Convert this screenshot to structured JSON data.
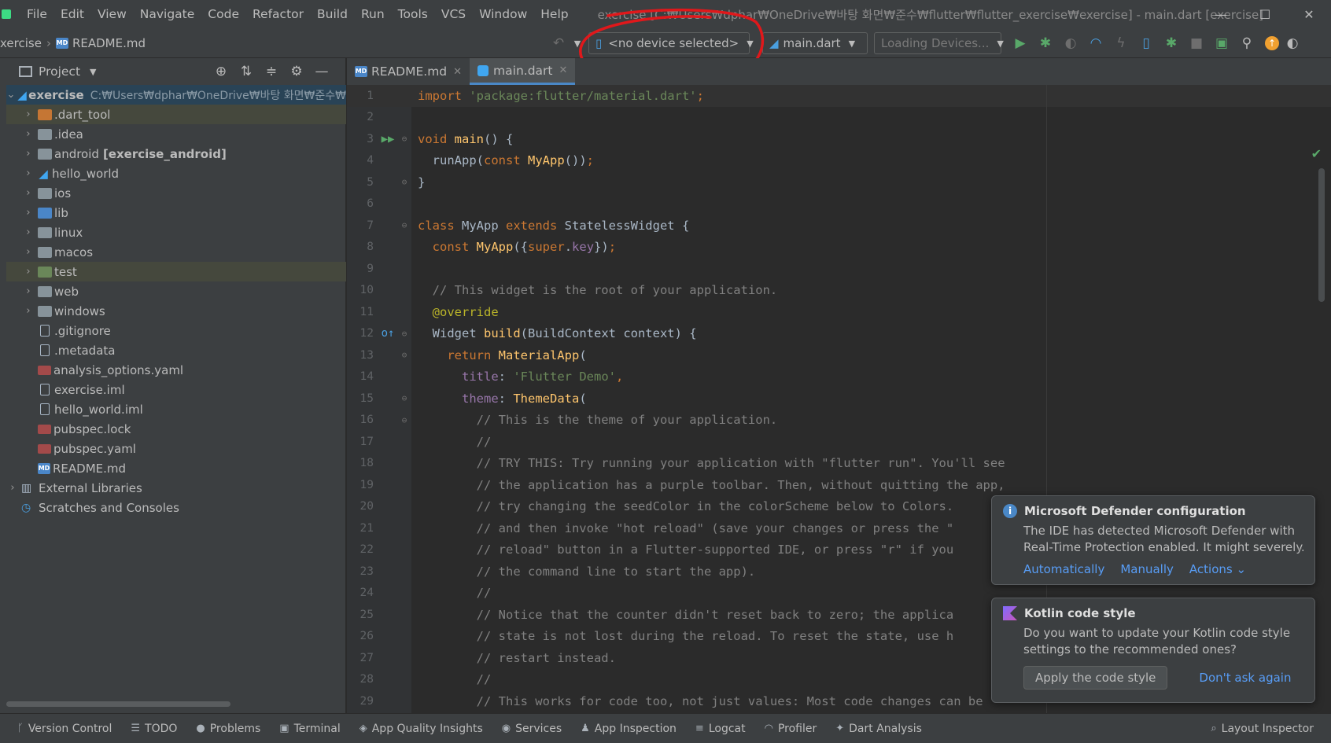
{
  "menu": [
    "File",
    "Edit",
    "View",
    "Navigate",
    "Code",
    "Refactor",
    "Build",
    "Run",
    "Tools",
    "VCS",
    "Window",
    "Help"
  ],
  "window_title": "exercise [C:₩Users₩dphar₩OneDrive₩바탕 화면₩준수₩flutter₩flutter_exercise₩exercise] - main.dart [exercise]",
  "window_controls": {
    "minimize": "—",
    "maximize": "☐",
    "close": "✕"
  },
  "breadcrumb": {
    "project": "xercise",
    "file": "README.md"
  },
  "toolbar": {
    "device": "<no device selected>",
    "config": "main.dart",
    "loading": "Loading Devices..."
  },
  "project_panel": {
    "title": "Project",
    "root": {
      "name": "exercise",
      "path": "C:₩Users₩dphar₩OneDrive₩바탕 화면₩준수₩"
    },
    "items": [
      {
        "label": ".dart_tool",
        "type": "folder-orange"
      },
      {
        "label": ".idea",
        "type": "folder"
      },
      {
        "label": "android",
        "extra": "[exercise_android]",
        "type": "folder"
      },
      {
        "label": "hello_world",
        "type": "flutter"
      },
      {
        "label": "ios",
        "type": "folder"
      },
      {
        "label": "lib",
        "type": "folder-blue"
      },
      {
        "label": "linux",
        "type": "folder"
      },
      {
        "label": "macos",
        "type": "folder"
      },
      {
        "label": "test",
        "type": "folder"
      },
      {
        "label": "web",
        "type": "folder"
      },
      {
        "label": "windows",
        "type": "folder"
      },
      {
        "label": ".gitignore",
        "type": "file"
      },
      {
        "label": ".metadata",
        "type": "file"
      },
      {
        "label": "analysis_options.yaml",
        "type": "yml"
      },
      {
        "label": "exercise.iml",
        "type": "file"
      },
      {
        "label": "hello_world.iml",
        "type": "file"
      },
      {
        "label": "pubspec.lock",
        "type": "yml"
      },
      {
        "label": "pubspec.yaml",
        "type": "yml"
      },
      {
        "label": "README.md",
        "type": "md"
      }
    ],
    "external_libraries": "External Libraries",
    "scratches": "Scratches and Consoles"
  },
  "tabs": [
    {
      "label": "README.md",
      "active": false
    },
    {
      "label": "main.dart",
      "active": true
    }
  ],
  "notifications": [
    {
      "title": "Microsoft Defender configuration",
      "body": [
        "The IDE has detected Microsoft Defender with",
        "Real-Time Protection enabled. It might severely..."
      ],
      "actions": [
        "Automatically",
        "Manually",
        "Actions ⌄"
      ]
    },
    {
      "title": "Kotlin code style",
      "body": [
        "Do you want to update your Kotlin code style",
        "settings to the recommended ones?"
      ],
      "button": "Apply the code style",
      "link": "Don't ask again"
    }
  ],
  "bottom_tools": [
    "Version Control",
    "TODO",
    "Problems",
    "Terminal",
    "App Quality Insights",
    "Services",
    "App Inspection",
    "Logcat",
    "Profiler",
    "Dart Analysis"
  ],
  "bottom_right": "Layout Inspector",
  "colors": {
    "accent": "#4a88c7",
    "annotation": "#e0181b"
  }
}
